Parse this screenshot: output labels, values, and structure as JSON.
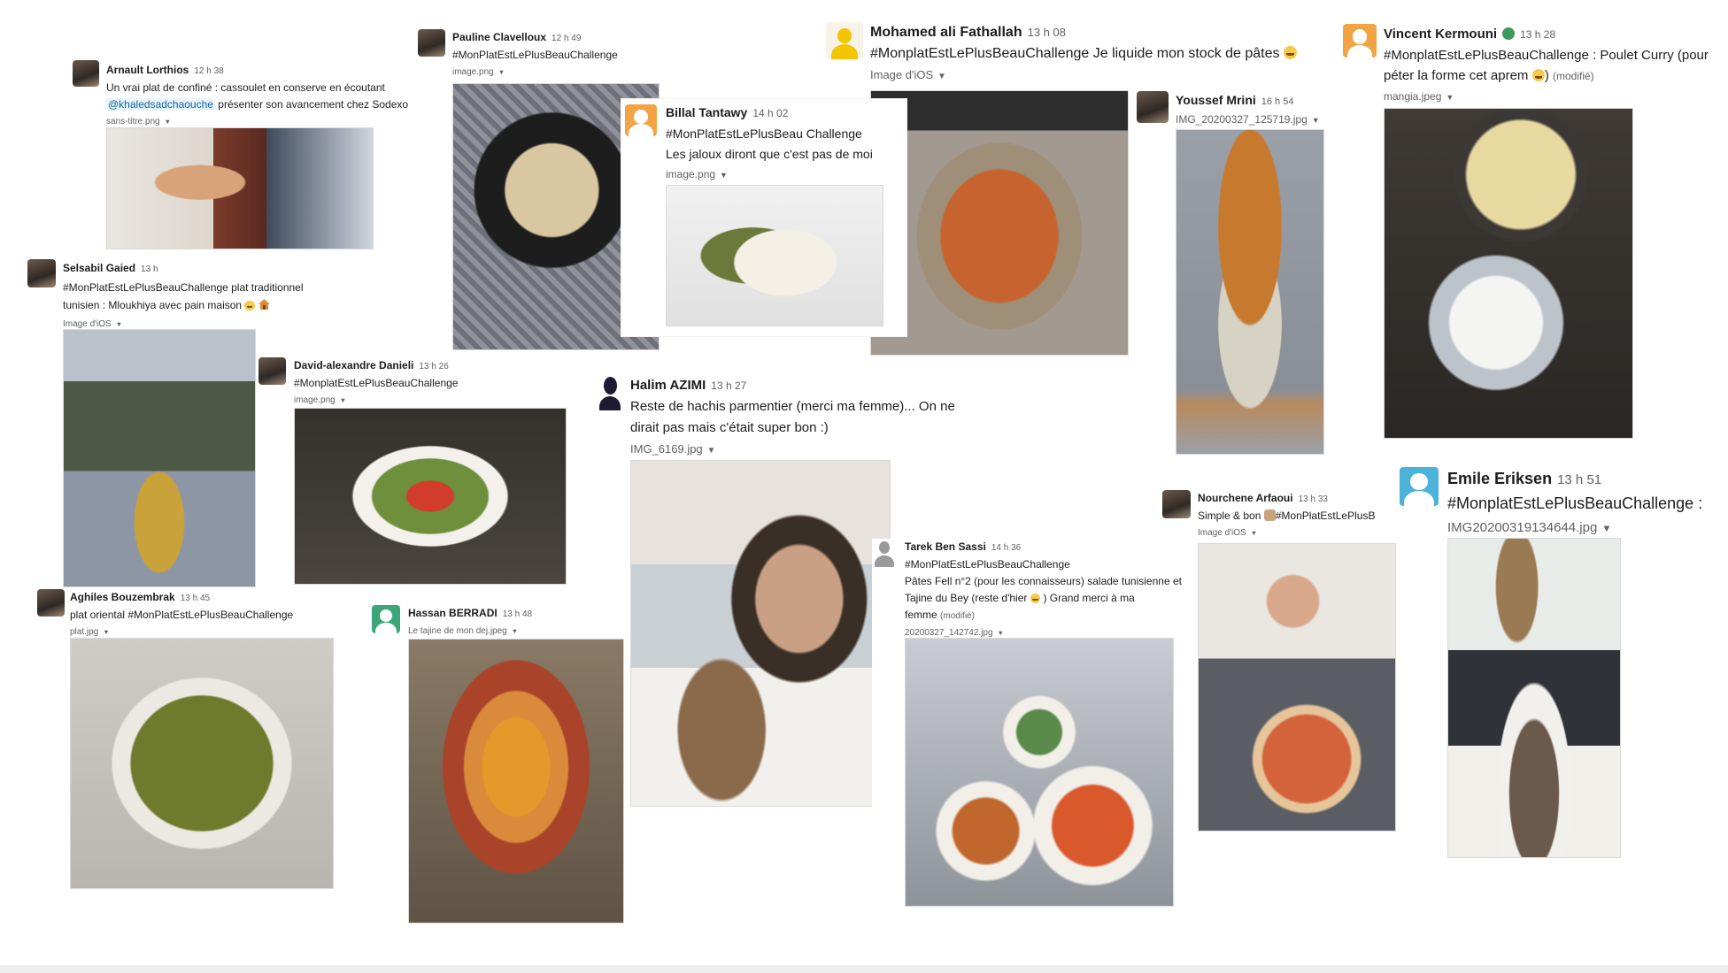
{
  "posts": {
    "arnault": {
      "name": "Arnault Lorthios",
      "time": "12 h 38",
      "text_before": "Un vrai plat de confiné : cassoulet en conserve en écoutant",
      "mention": "@khaledsadchaouche",
      "text_after": "présenter son avancement chez Sodexo",
      "file": "sans-titre.png"
    },
    "pauline": {
      "name": "Pauline Clavelloux",
      "time": "12 h 49",
      "text": "#MonPlatEstLePlusBeauChallenge",
      "file": "image.png"
    },
    "billal": {
      "name": "Billal Tantawy",
      "time": "14 h 02",
      "text1": "#MonPlatEstLePlusBeau Challenge",
      "text2": "Les jaloux diront que c'est pas de moi",
      "file": "image.png"
    },
    "mohamed": {
      "name": "Mohamed ali Fathallah",
      "time": "13 h 08",
      "text": "#MonplatEstLePlusBeauChallenge Je liquide mon stock de pâtes",
      "file": "Image d'iOS"
    },
    "youssef": {
      "name": "Youssef Mrini",
      "time": "16 h 54",
      "file": "IMG_20200327_125719.jpg"
    },
    "vincent": {
      "name": "Vincent Kermouni",
      "time": "13 h 28",
      "text1": "#MonplatEstLePlusBeauChallenge : Poulet Curry (pour",
      "text2": "péter la forme cet aprem",
      "edited": "(modifié)",
      "file": "mangia.jpeg"
    },
    "selsabil": {
      "name": "Selsabil Gaied",
      "time": "13 h",
      "text1": "#MonPlatEstLePlusBeauChallenge plat traditionnel",
      "text2": "tunisien : Mloukhiya avec pain maison",
      "file": "Image d'iOS"
    },
    "david": {
      "name": "David-alexandre Danieli",
      "time": "13 h 26",
      "text": "#MonplatEstLePlusBeauChallenge",
      "file": "image.png"
    },
    "halim": {
      "name": "Halim AZIMI",
      "time": "13 h 27",
      "text1": "Reste de hachis parmentier (merci ma femme)... On ne",
      "text2": "dirait pas mais c'était super bon :)",
      "file": "IMG_6169.jpg"
    },
    "nourchene": {
      "name": "Nourchene Arfaoui",
      "time": "13 h 33",
      "text": "Simple & bon",
      "tag": "#MonPlatEstLePlusB",
      "file": "Image d'iOS"
    },
    "emile": {
      "name": "Emile Eriksen",
      "time": "13 h 51",
      "text": "#MonplatEstLePlusBeauChallenge :",
      "file": "IMG20200319134644.jpg"
    },
    "tarek": {
      "name": "Tarek Ben Sassi",
      "time": "14 h 36",
      "text1": "#MonPlatEstLePlusBeauChallenge",
      "text2": "Pâtes Fell n°2 (pour les connaisseurs) salade tunisienne et",
      "text3": "Tajine du Bey (reste d'hier",
      "text3b": ") Grand merci à ma",
      "text4": "femme",
      "edited": "(modifié)",
      "file": "20200327_142742.jpg"
    },
    "aghiles": {
      "name": "Aghiles Bouzembrak",
      "time": "13 h 45",
      "text": "plat oriental  #MonPlatEstLePlusBeauChallenge",
      "file": "plat.jpg"
    },
    "hassan": {
      "name": "Hassan BERRADI",
      "time": "13 h 48",
      "file": "Le tajine de mon dej.jpeg"
    }
  },
  "colors": {
    "mention": "#1264a3",
    "muted": "#616061",
    "text": "#1d1c1d"
  }
}
